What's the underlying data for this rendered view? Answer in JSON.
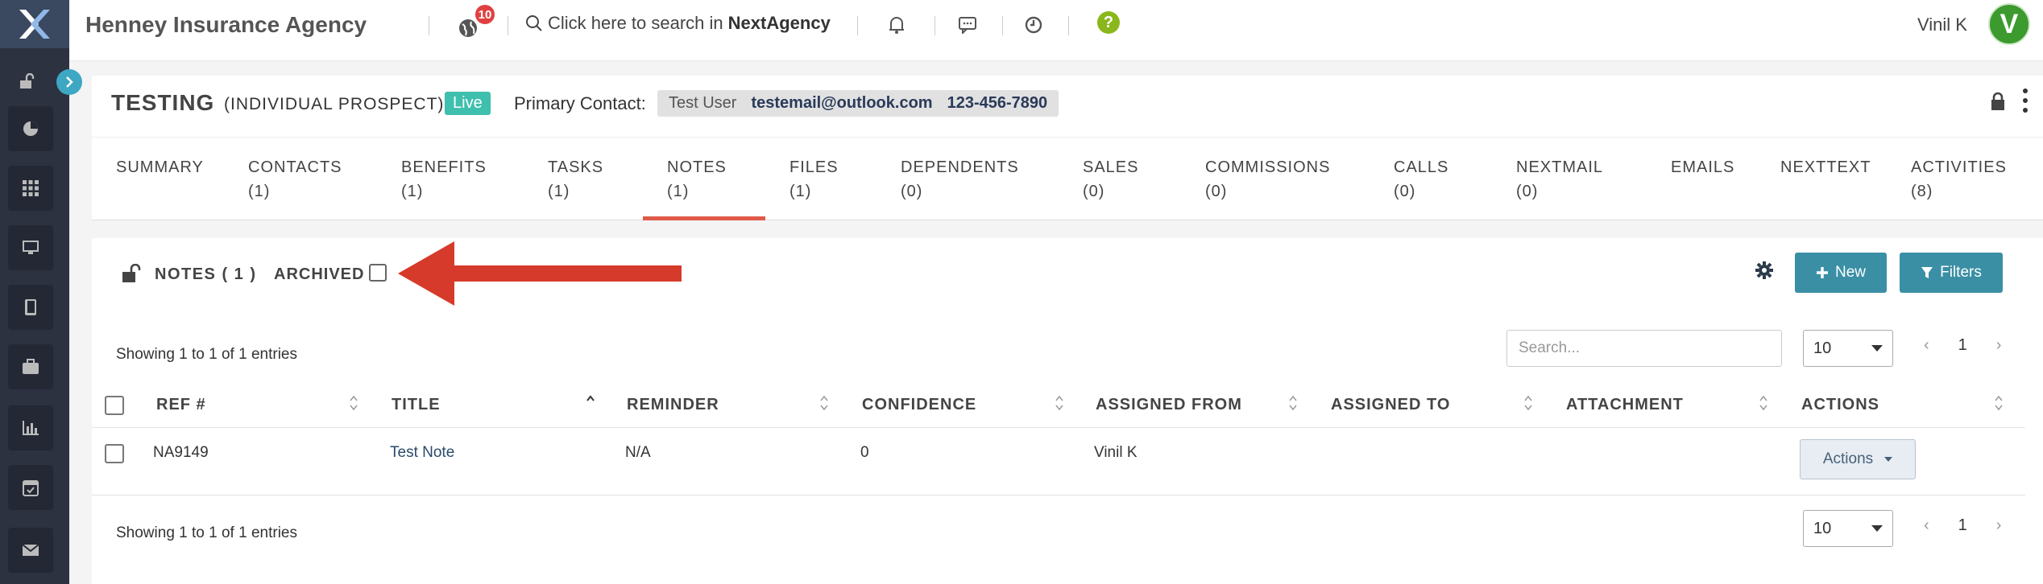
{
  "topbar": {
    "agency_name": "Henney Insurance Agency",
    "notification_count": "10",
    "search_prefix": "Click here to search in",
    "search_brand": "NextAgency",
    "help_glyph": "?",
    "user_name": "Vinil K",
    "avatar_initial": "V"
  },
  "header": {
    "record_name": "TESTING",
    "record_type": "(INDIVIDUAL PROSPECT)",
    "status": "Live",
    "primary_contact_label": "Primary Contact:",
    "contact_name": "Test User",
    "contact_email": "testemail@outlook.com",
    "contact_phone": "123-456-7890"
  },
  "tabs": [
    {
      "label": "SUMMARY",
      "count": ""
    },
    {
      "label": "CONTACTS",
      "count": "(1)"
    },
    {
      "label": "BENEFITS",
      "count": "(1)"
    },
    {
      "label": "TASKS",
      "count": "(1)"
    },
    {
      "label": "NOTES",
      "count": "(1)"
    },
    {
      "label": "FILES",
      "count": "(1)"
    },
    {
      "label": "DEPENDENTS",
      "count": "(0)"
    },
    {
      "label": "SALES",
      "count": "(0)"
    },
    {
      "label": "COMMISSIONS",
      "count": "(0)"
    },
    {
      "label": "CALLS",
      "count": "(0)"
    },
    {
      "label": "NEXTMAIL",
      "count": "(0)"
    },
    {
      "label": "EMAILS",
      "count": ""
    },
    {
      "label": "NEXTTEXT",
      "count": ""
    },
    {
      "label": "ACTIVITIES",
      "count": "(8)"
    }
  ],
  "active_tab": "NOTES",
  "notes": {
    "title": "NOTES ( 1 )",
    "archived_label": "ARCHIVED",
    "new_label": "New",
    "filters_label": "Filters",
    "search_placeholder": "Search...",
    "page_size": "10",
    "page_number": "1",
    "showing_text": "Showing 1 to 1 of 1 entries",
    "columns": [
      "REF #",
      "TITLE",
      "REMINDER",
      "CONFIDENCE",
      "ASSIGNED FROM",
      "ASSIGNED TO",
      "ATTACHMENT",
      "ACTIONS"
    ],
    "rows": [
      {
        "ref": "NA9149",
        "title": "Test Note",
        "reminder": "N/A",
        "confidence": "0",
        "assigned_from": "Vinil K",
        "assigned_to": "",
        "attachment": "",
        "action_label": "Actions"
      }
    ]
  },
  "colors": {
    "sidebar": "#2c3240",
    "accent_teal": "#3a8fa5",
    "live_badge": "#3fbfad",
    "active_tab_underline": "#e05a4a",
    "annotation_arrow": "#d63a2a"
  }
}
